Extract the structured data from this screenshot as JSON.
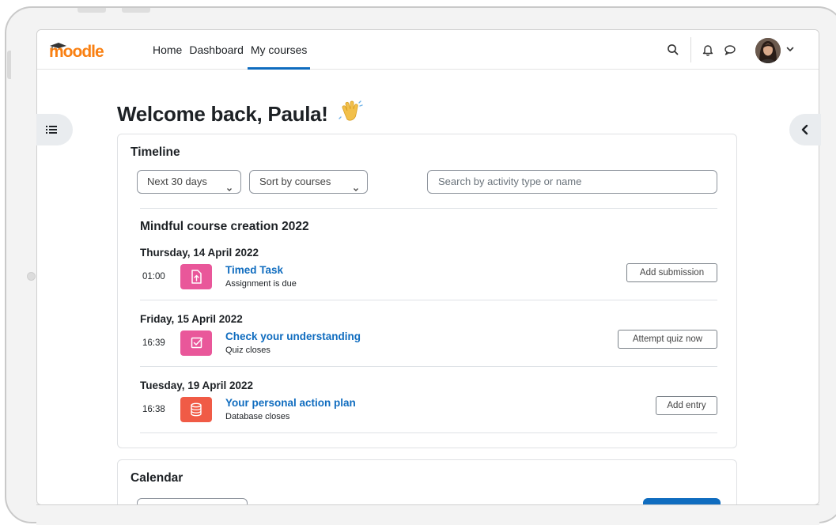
{
  "navbar": {
    "logo": "moodle",
    "links": [
      "Home",
      "Dashboard",
      "My courses"
    ],
    "active_link": "My courses",
    "icons": [
      "search-icon",
      "bell-icon",
      "chat-icon",
      "chevron-down-icon"
    ]
  },
  "welcome": "Welcome back, Paula!",
  "timeline": {
    "title": "Timeline",
    "range_filter": "Next 30 days",
    "sort_filter": "Sort by courses",
    "search_placeholder": "Search by activity type or name",
    "course": "Mindful course creation 2022",
    "events": [
      {
        "date": "Thursday, 14 April 2022",
        "time": "01:00",
        "name": "Timed Task",
        "subtitle": "Assignment is due",
        "action": "Add submission",
        "icon": "assignment-icon",
        "icon_color": "#e9579a"
      },
      {
        "date": "Friday, 15 April 2022",
        "time": "16:39",
        "name": "Check your understanding",
        "subtitle": "Quiz closes",
        "action": "Attempt quiz now",
        "icon": "quiz-icon",
        "icon_color": "#e9579a"
      },
      {
        "date": "Tuesday, 19 April 2022",
        "time": "16:38",
        "name": "Your personal action plan",
        "subtitle": "Database closes",
        "action": "Add entry",
        "icon": "database-icon",
        "icon_color": "#f05b46"
      }
    ]
  },
  "calendar": {
    "title": "Calendar"
  },
  "colors": {
    "brand": "#f98012",
    "accent": "#0f6cbf"
  }
}
